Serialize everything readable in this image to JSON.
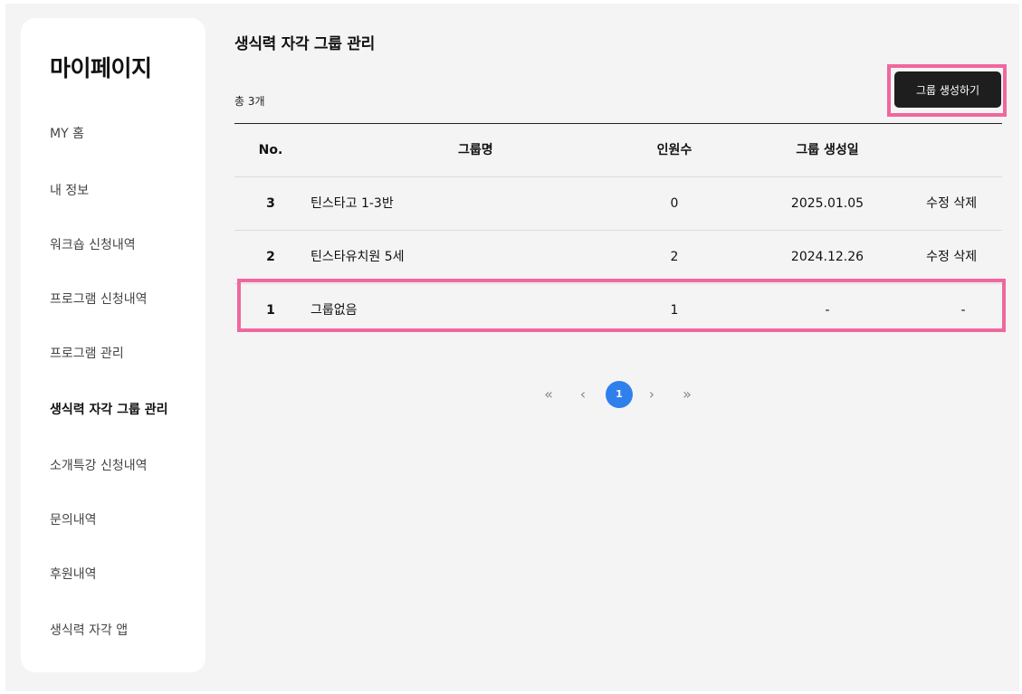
{
  "sidebar": {
    "title": "마이페이지",
    "items": [
      {
        "label": "MY 홈"
      },
      {
        "label": "내 정보"
      },
      {
        "label": "워크숍 신청내역"
      },
      {
        "label": "프로그램 신청내역"
      },
      {
        "label": "프로그램 관리"
      },
      {
        "label": "생식력 자각 그룹 관리"
      },
      {
        "label": "소개특강 신청내역"
      },
      {
        "label": "문의내역"
      },
      {
        "label": "후원내역"
      },
      {
        "label": "생식력 자각 앱"
      }
    ],
    "active_index": 5
  },
  "main": {
    "title": "생식력 자각 그룹 관리",
    "total": "총 3개",
    "create_button": "그룹 생성하기",
    "table": {
      "headers": {
        "no": "No.",
        "name": "그룹명",
        "count": "인원수",
        "created": "그룹 생성일"
      },
      "rows": [
        {
          "no": "3",
          "name": "틴스타고 1-3반",
          "count": "0",
          "created": "2025.01.05",
          "edit": "수정",
          "delete": "삭제"
        },
        {
          "no": "2",
          "name": "틴스타유치원 5세",
          "count": "2",
          "created": "2024.12.26",
          "edit": "수정",
          "delete": "삭제"
        },
        {
          "no": "1",
          "name": "그룹없음",
          "count": "1",
          "created": "-",
          "action": "-"
        }
      ]
    },
    "pagination": {
      "first": "«",
      "prev": "‹",
      "current": "1",
      "next": "›",
      "last": "»"
    }
  },
  "highlight_color": "#f0679e",
  "accent_color": "#2f80ed"
}
